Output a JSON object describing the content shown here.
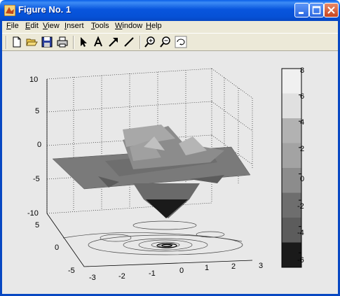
{
  "window": {
    "title": "Figure No. 1"
  },
  "menu": [
    {
      "pre": "",
      "ul": "F",
      "post": "ile"
    },
    {
      "pre": "",
      "ul": "E",
      "post": "dit"
    },
    {
      "pre": "",
      "ul": "V",
      "post": "iew"
    },
    {
      "pre": "",
      "ul": "I",
      "post": "nsert"
    },
    {
      "pre": "",
      "ul": "T",
      "post": "ools"
    },
    {
      "pre": "",
      "ul": "W",
      "post": "indow"
    },
    {
      "pre": "",
      "ul": "H",
      "post": "elp"
    }
  ],
  "toolbar": {
    "buttons": [
      "new-file-icon",
      "open-folder-icon",
      "save-icon",
      "print-icon",
      "select-arrow-icon",
      "text-A-icon",
      "arrow-icon",
      "line-icon",
      "zoom-in-icon",
      "zoom-out-icon",
      "rotate-3d-icon"
    ]
  },
  "plot": {
    "z_ticks": [
      "10",
      "5",
      "0",
      "-5",
      "-10"
    ],
    "y_ticks": [
      "5",
      "0",
      "-5"
    ],
    "x_ticks": [
      "-3",
      "-2",
      "-1",
      "0",
      "1",
      "2",
      "3"
    ],
    "colorbar_ticks": [
      "8",
      "6",
      "4",
      "2",
      "0",
      "-2",
      "-4",
      "-6"
    ],
    "colormap": [
      "#f0f0f0",
      "#e0e0e0",
      "#b2b2b2",
      "#a3a3a3",
      "#8c8c8c",
      "#6e6e6e",
      "#5c5c5c",
      "#1a1a1a"
    ]
  }
}
